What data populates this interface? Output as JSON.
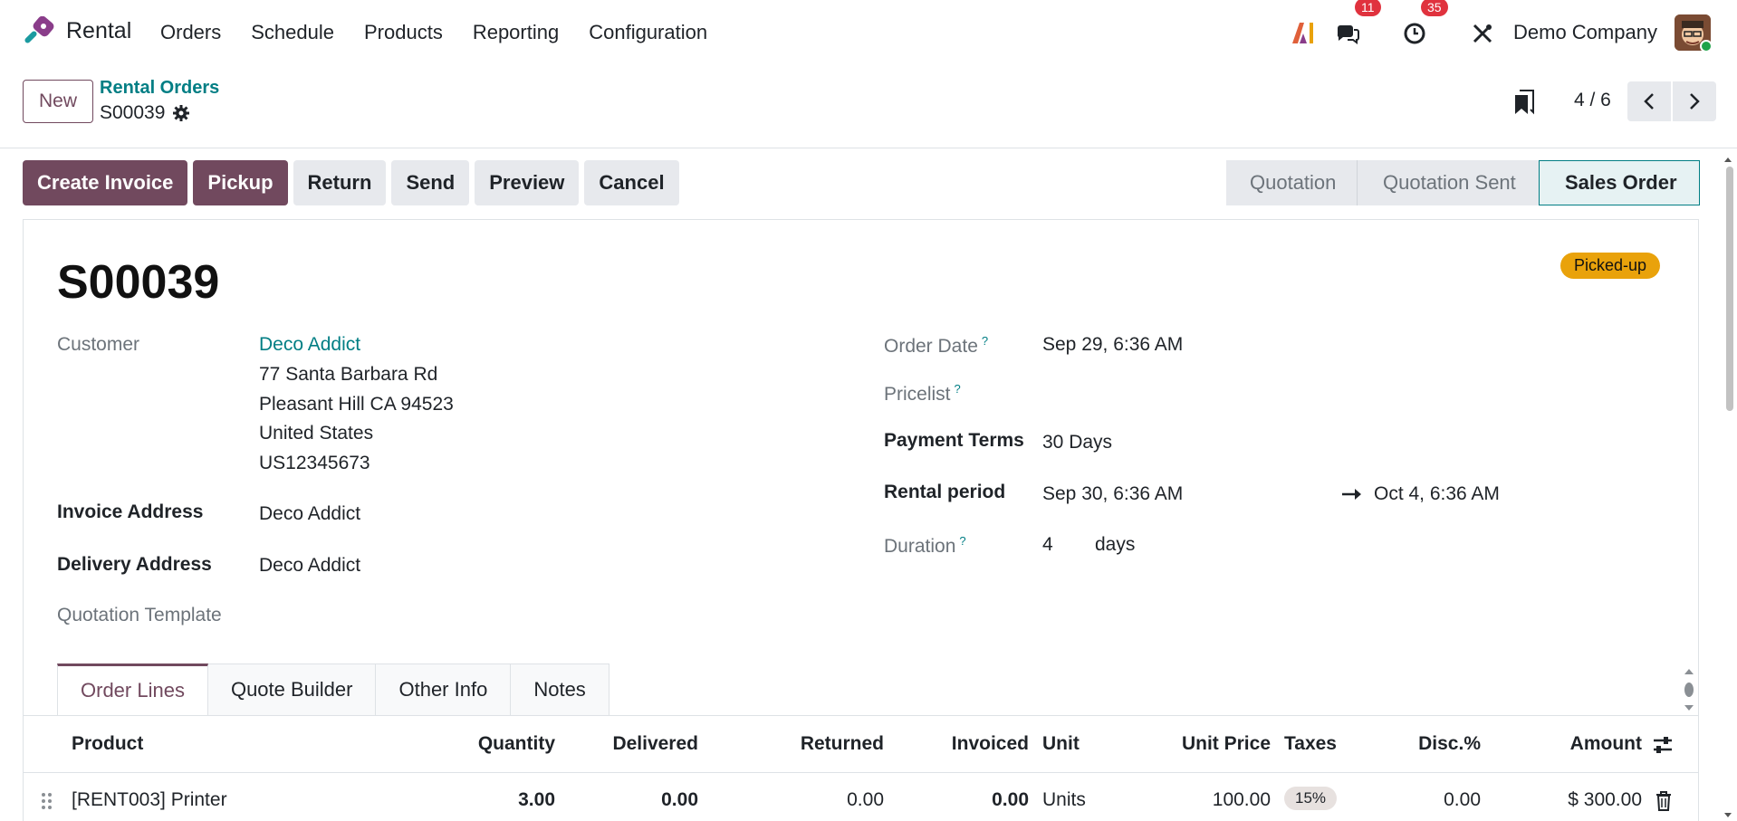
{
  "app": {
    "name": "Rental",
    "menu": [
      "Orders",
      "Schedule",
      "Products",
      "Reporting",
      "Configuration"
    ],
    "messages_count": "11",
    "activities_count": "35",
    "company": "Demo Company"
  },
  "control": {
    "new_label": "New",
    "breadcrumb_parent": "Rental Orders",
    "breadcrumb_current": "S00039",
    "pager": "4 / 6"
  },
  "actions": [
    "Create Invoice",
    "Pickup",
    "Return",
    "Send",
    "Preview",
    "Cancel"
  ],
  "statusbar": [
    "Quotation",
    "Quotation Sent",
    "Sales Order"
  ],
  "record": {
    "title": "S00039",
    "ribbon": "Picked-up",
    "customer_label": "Customer",
    "customer_name": "Deco Addict",
    "address_lines": [
      "77 Santa Barbara Rd",
      "Pleasant Hill CA 94523",
      "United States",
      "US12345673"
    ],
    "invoice_address_label": "Invoice Address",
    "invoice_address": "Deco Addict",
    "delivery_address_label": "Delivery Address",
    "delivery_address": "Deco Addict",
    "quotation_template_label": "Quotation Template",
    "order_date_label": "Order Date",
    "order_date": "Sep 29, 6:36 AM",
    "pricelist_label": "Pricelist",
    "payment_terms_label": "Payment Terms",
    "payment_terms": "30 Days",
    "rental_period_label": "Rental period",
    "rental_start": "Sep 30, 6:36 AM",
    "rental_end": "Oct 4, 6:36 AM",
    "duration_label": "Duration",
    "duration_value": "4",
    "duration_unit": "days",
    "help_mark": "?"
  },
  "tabs": [
    "Order Lines",
    "Quote Builder",
    "Other Info",
    "Notes"
  ],
  "table": {
    "columns": [
      "Product",
      "Quantity",
      "Delivered",
      "Returned",
      "Invoiced",
      "Unit",
      "Unit Price",
      "Taxes",
      "Disc.%",
      "Amount"
    ],
    "rows": [
      {
        "product": "[RENT003] Printer",
        "quantity": "3.00",
        "delivered": "0.00",
        "returned": "0.00",
        "invoiced": "0.00",
        "unit": "Units",
        "unit_price": "100.00",
        "taxes": "15%",
        "discount": "0.00",
        "amount": "$ 300.00"
      }
    ]
  },
  "colors": {
    "primary": "#71495e",
    "link": "#017e84",
    "ribbon": "#e9a20b",
    "badge": "#e0323e"
  }
}
